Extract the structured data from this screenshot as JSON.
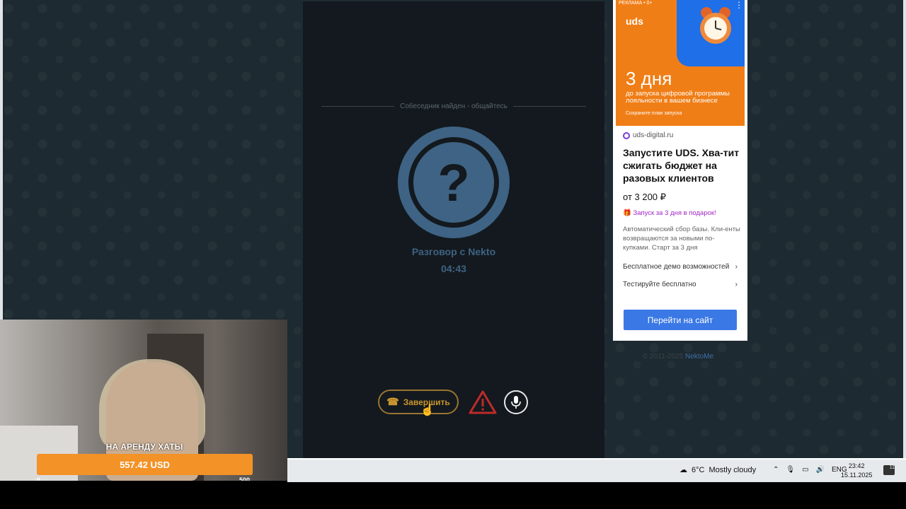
{
  "chat": {
    "status": "Собеседник найден - общайтесь",
    "avatar_symbol": "?",
    "title": "Разговор с Nekto",
    "timer": "04:43",
    "end_label": "Завершить",
    "end_icon": "phone-hangup-icon",
    "report_icon": "warning-icon",
    "mic_icon": "microphone-icon"
  },
  "ad": {
    "marker": "РЕКЛАМА • 0+",
    "brand": "uds",
    "days": "3 дня",
    "banner_sub": "до запуска цифровой программы лояльности в вашем бизнесе",
    "save": "Сохраните план запуска",
    "site": "uds-digital.ru",
    "title": "Запустите UDS. Хва-тит сжигать бюджет на разовых клиентов",
    "price": "от 3 200 ₽",
    "gift": "Запуск за 3 дня в подарок!",
    "desc": "Автоматический сбор базы. Кли-енты возвращаются за новыми по-купками. Старт за 3 дня",
    "link1": "Бесплатное демо возможностей",
    "link2": "Тестируйте бесплатно",
    "button": "Перейти на сайт",
    "colors": {
      "banner": "#f07e16",
      "accent": "#1e6fe8",
      "button": "#3a78e6"
    }
  },
  "footer": {
    "copy": "© 2011-2025",
    "link": "NektoMe"
  },
  "webcam": {
    "label": "НА АРЕНДУ ХАТЫ",
    "amount": "557.42 USD",
    "min": "0",
    "max": "500",
    "progress_value": 557.42,
    "progress_max": 500
  },
  "taskbar": {
    "temp": "6°C",
    "weather": "Mostly cloudy",
    "lang": "ENG",
    "time": "23:42",
    "date": "15.11.2025",
    "notif_count": "11"
  }
}
